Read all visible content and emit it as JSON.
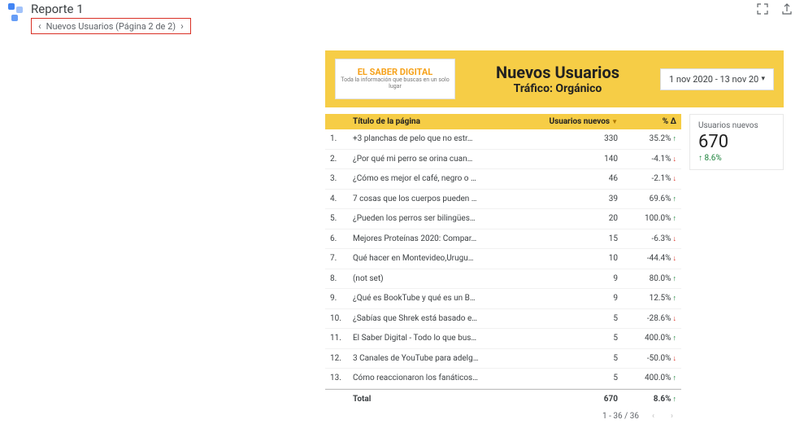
{
  "header": {
    "report_title": "Reporte 1",
    "breadcrumb": "Nuevos Usuarios (Página 2 de 2)"
  },
  "band": {
    "brand_title": "EL SABER DIGITAL",
    "brand_sub": "Toda la información que buscas en un solo lugar",
    "heading": "Nuevos Usuarios",
    "sub_heading": "Tráfico: Orgánico",
    "date_range": "1 nov 2020 - 13 nov 20"
  },
  "table": {
    "columns": {
      "title": "Título de la página",
      "users": "Usuarios nuevos",
      "delta": "% Δ"
    },
    "rows": [
      {
        "n": "1.",
        "title": "+3 planchas de pelo que no estr…",
        "users": "330",
        "delta": "35.2%",
        "dir": "up"
      },
      {
        "n": "2.",
        "title": "¿Por qué mi perro se orina cuan…",
        "users": "140",
        "delta": "-4.1%",
        "dir": "down"
      },
      {
        "n": "3.",
        "title": "¿Cómo es mejor el café, negro o …",
        "users": "46",
        "delta": "-2.1%",
        "dir": "down"
      },
      {
        "n": "4.",
        "title": "7 cosas que los cuerpos pueden …",
        "users": "39",
        "delta": "69.6%",
        "dir": "up"
      },
      {
        "n": "5.",
        "title": "¿Pueden los perros ser bilingües…",
        "users": "20",
        "delta": "100.0%",
        "dir": "up"
      },
      {
        "n": "6.",
        "title": "Mejores Proteínas 2020: Compar…",
        "users": "15",
        "delta": "-6.3%",
        "dir": "down"
      },
      {
        "n": "7.",
        "title": "Qué hacer en Montevideo,Urugu…",
        "users": "10",
        "delta": "-44.4%",
        "dir": "down"
      },
      {
        "n": "8.",
        "title": "(not set)",
        "users": "9",
        "delta": "80.0%",
        "dir": "up"
      },
      {
        "n": "9.",
        "title": "¿Qué es BookTube y qué es un B…",
        "users": "9",
        "delta": "12.5%",
        "dir": "up"
      },
      {
        "n": "10.",
        "title": "¿Sabías que Shrek está basado e…",
        "users": "5",
        "delta": "-28.6%",
        "dir": "down"
      },
      {
        "n": "11.",
        "title": "El Saber Digital - Todo lo que bus…",
        "users": "5",
        "delta": "400.0%",
        "dir": "up"
      },
      {
        "n": "12.",
        "title": "3 Canales de YouTube para adelg…",
        "users": "5",
        "delta": "-50.0%",
        "dir": "down"
      },
      {
        "n": "13.",
        "title": "Cómo reaccionaron los fanáticos…",
        "users": "5",
        "delta": "400.0%",
        "dir": "up"
      }
    ],
    "total": {
      "label": "Total",
      "users": "670",
      "delta": "8.6%",
      "dir": "up"
    },
    "pager": "1 - 36 / 36"
  },
  "kpi": {
    "label": "Usuarios nuevos",
    "value": "670",
    "delta": "8.6%"
  }
}
